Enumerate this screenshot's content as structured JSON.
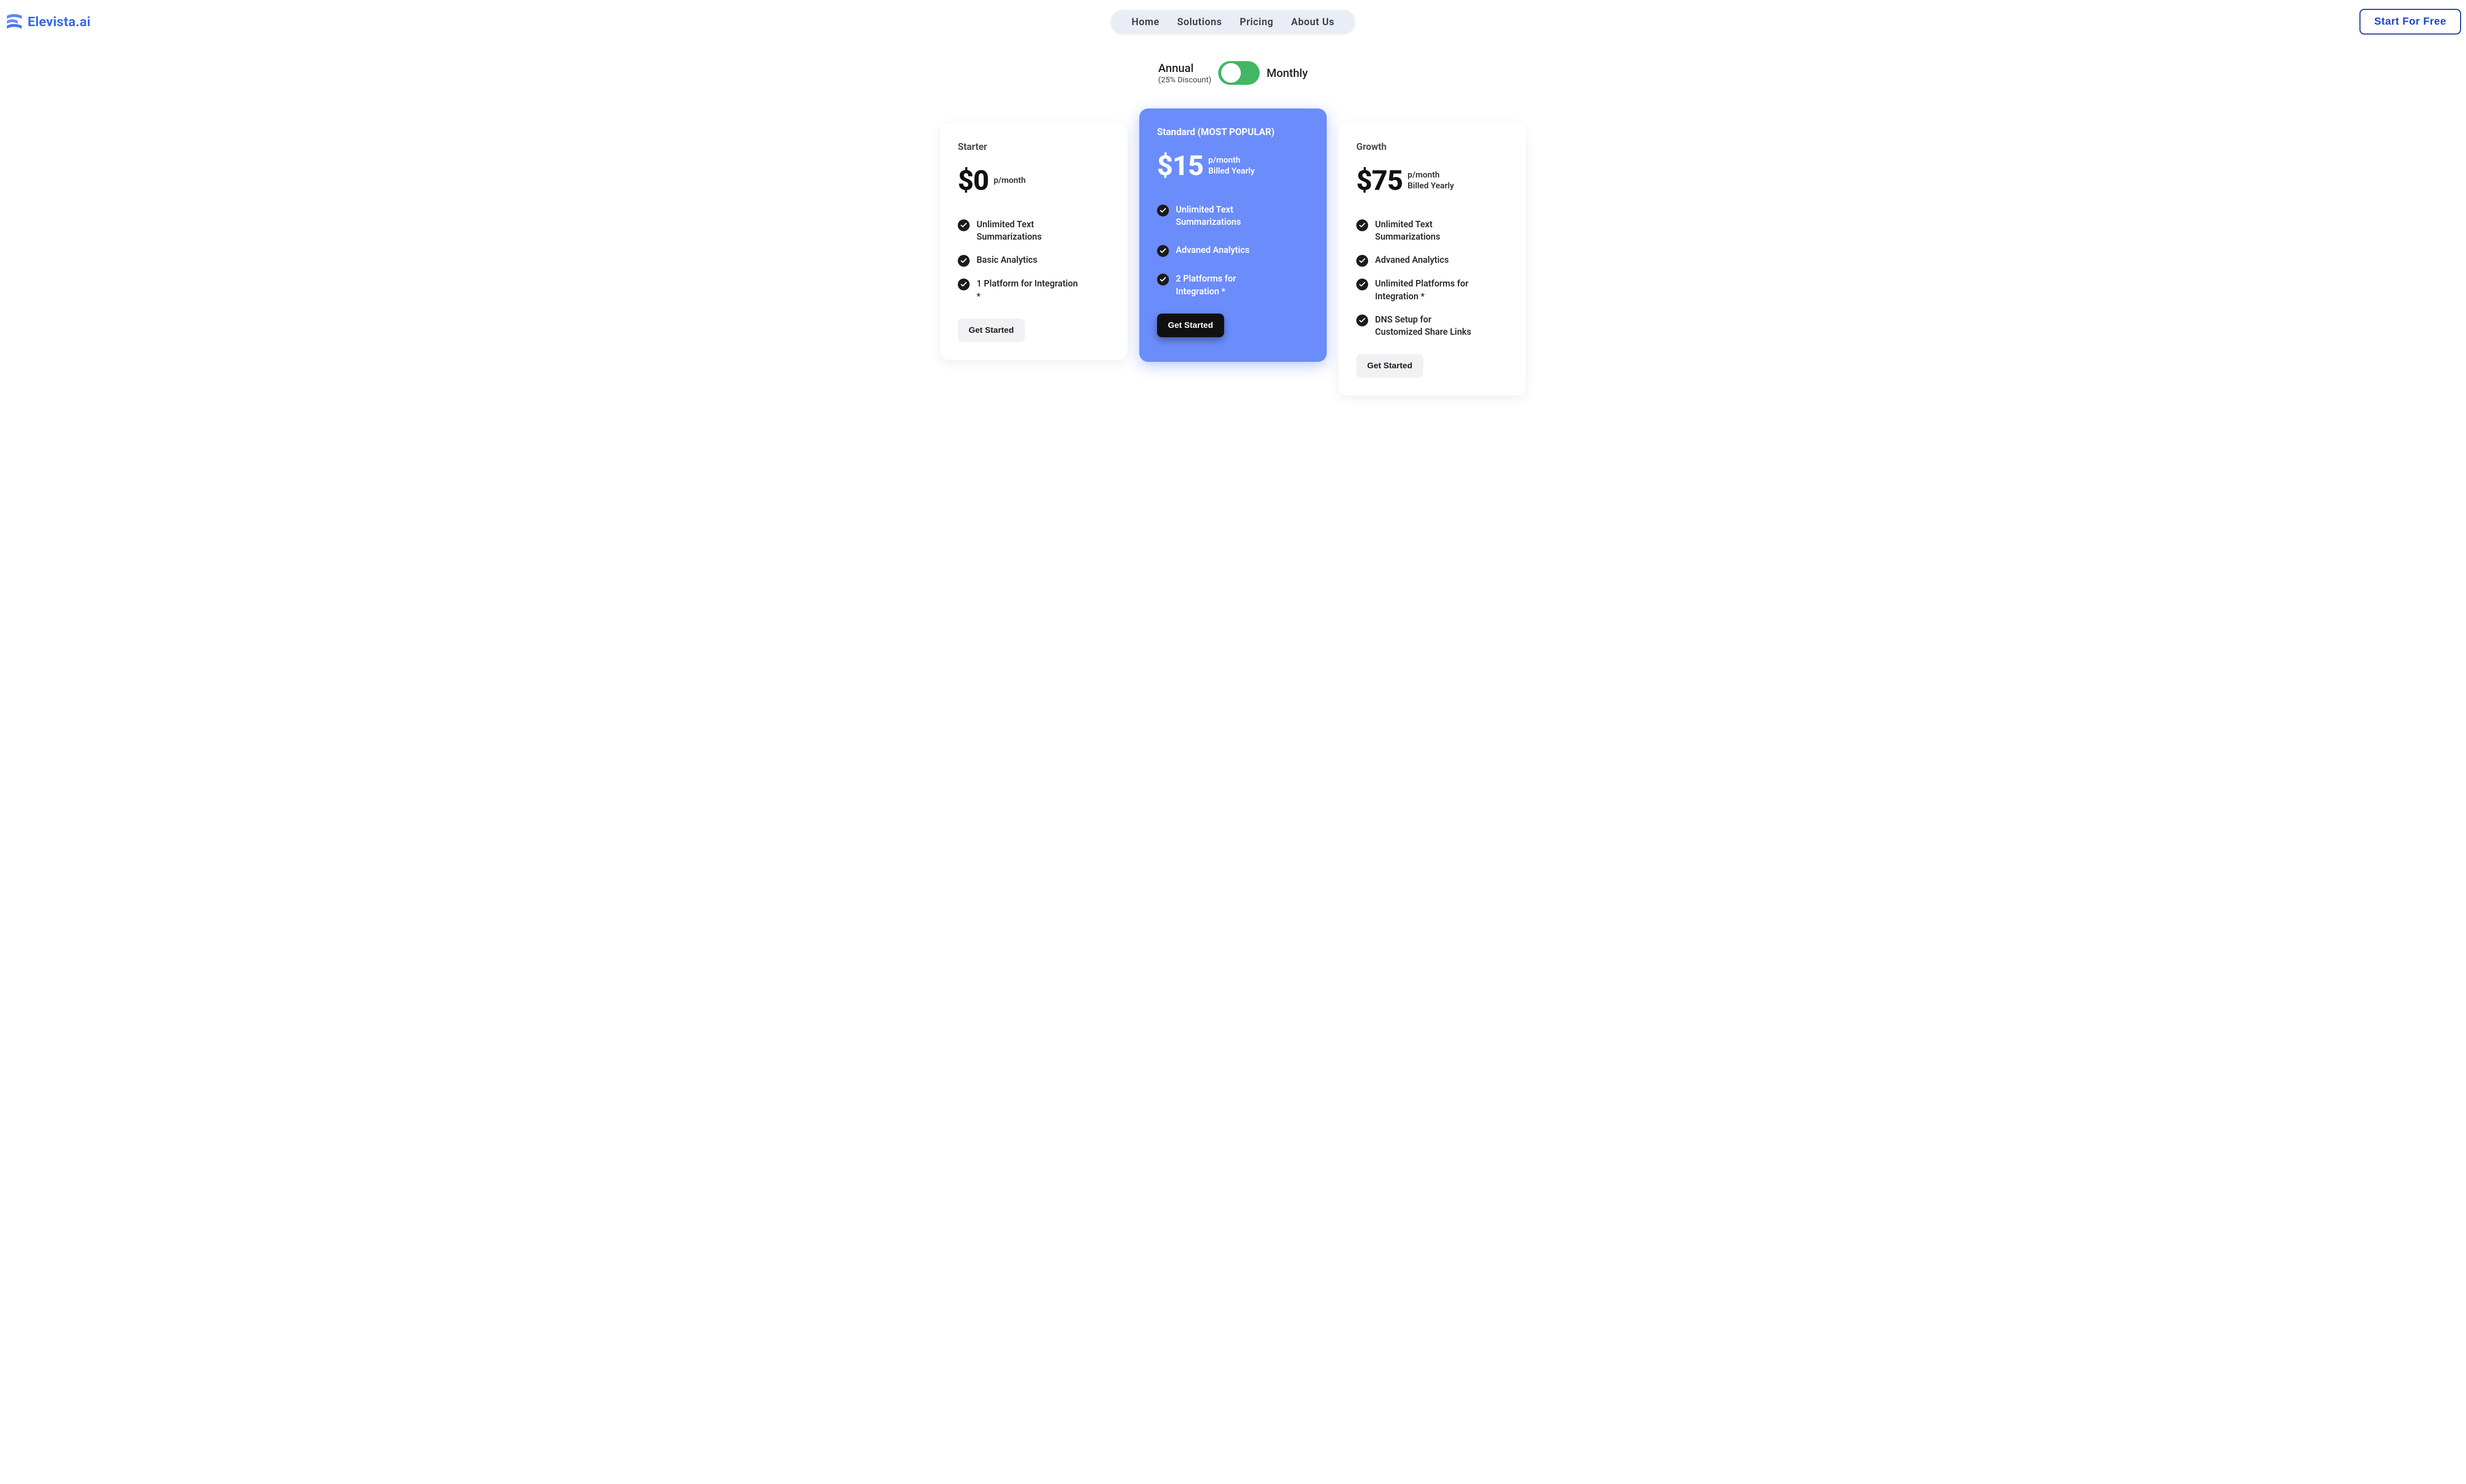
{
  "brand": {
    "name": "Elevista.ai"
  },
  "nav": {
    "items": [
      "Home",
      "Solutions",
      "Pricing",
      "About Us"
    ]
  },
  "cta": {
    "label": "Start For Free"
  },
  "billingToggle": {
    "left": {
      "label": "Annual",
      "sub": "(25% Discount)"
    },
    "right": {
      "label": "Monthly"
    },
    "state": "annual"
  },
  "plans": [
    {
      "id": "starter",
      "name": "Starter",
      "price": "$0",
      "period": "p/month",
      "billing": "",
      "features": [
        "Unlimited Text Summarizations",
        "Basic Analytics",
        "1 Platform for Integration *"
      ],
      "cta": "Get Started",
      "featured": false
    },
    {
      "id": "standard",
      "name": "Standard (MOST POPULAR)",
      "price": "$15",
      "period": "p/month",
      "billing": "Billed Yearly",
      "features": [
        "Unlimited Text Summarizations",
        "Advaned Analytics",
        "2 Platforms for Integration *"
      ],
      "cta": "Get Started",
      "featured": true
    },
    {
      "id": "growth",
      "name": "Growth",
      "price": "$75",
      "period": "p/month",
      "billing": "Billed Yearly",
      "features": [
        "Unlimited Text Summarizations",
        "Advaned Analytics",
        "Unlimited Platforms for Integration *",
        "DNS Setup for Customized Share Links"
      ],
      "cta": "Get Started",
      "featured": false
    }
  ],
  "colors": {
    "accent": "#6b8cfb",
    "brand": "#3869e6",
    "toggleOn": "#43b763"
  }
}
